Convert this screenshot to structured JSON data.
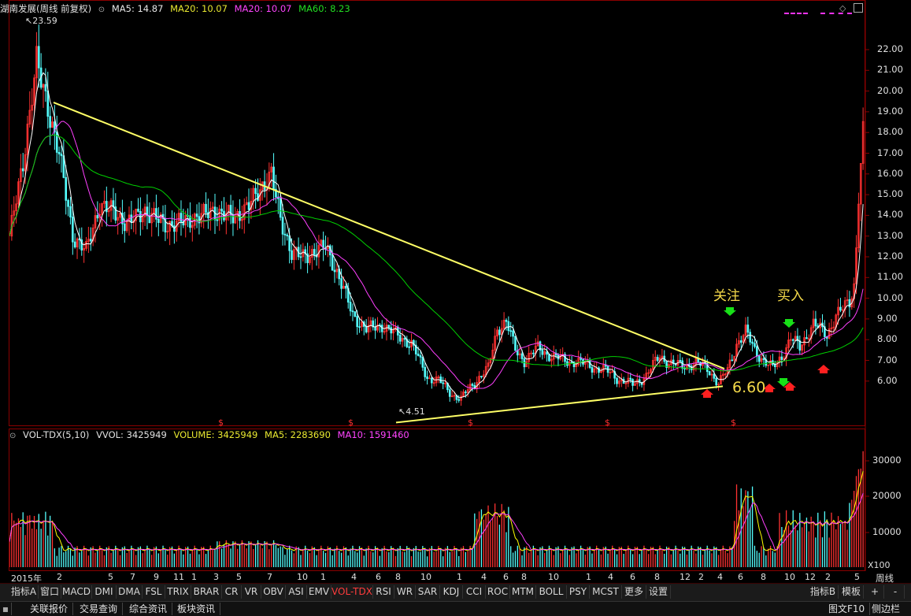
{
  "upper_header": {
    "title": "湖南发展(周线 前复权)",
    "ma5": "MA5: 14.87",
    "ma20": "MA20: 10.07",
    "ma20b": "MA20: 10.07",
    "ma60": "MA60: 8.23"
  },
  "lower_header": {
    "title": "VOL-TDX(5,10)",
    "vvol": "VVOL: 3425949",
    "volume": "VOLUME: 3425949",
    "ma5": "MA5: 2283690",
    "ma10": "MA10: 1591460"
  },
  "price_axis": [
    "22.00",
    "21.00",
    "20.00",
    "19.00",
    "18.00",
    "17.00",
    "16.00",
    "15.00",
    "14.00",
    "13.00",
    "12.00",
    "11.00",
    "10.00",
    "9.00",
    "8.00",
    "7.00",
    "6.00"
  ],
  "volume_axis": [
    "30000",
    "20000",
    "10000"
  ],
  "volume_unit": "X100",
  "time_axis": [
    "2015年",
    "2",
    "5",
    "7",
    "9",
    "11",
    "1",
    "3",
    "5",
    "7",
    "10",
    "1",
    "4",
    "6",
    "8",
    "10",
    "1",
    "4",
    "6",
    "8",
    "10",
    "1",
    "4",
    "6",
    "8",
    "12",
    "2",
    "4",
    "6",
    "8",
    "10",
    "12",
    "2",
    "5"
  ],
  "period_label": "周线",
  "annotations": {
    "high_label": "23.59",
    "low_label": "4.51",
    "watch": "关注",
    "buy": "买入",
    "breakout_price": "6.60"
  },
  "dividend_marker": "$",
  "tabs": [
    {
      "label": "指标A"
    },
    {
      "label": "窗口"
    },
    {
      "label": "MACD"
    },
    {
      "label": "DMI"
    },
    {
      "label": "DMA"
    },
    {
      "label": "FSL"
    },
    {
      "label": "TRIX"
    },
    {
      "label": "BRAR"
    },
    {
      "label": "CR"
    },
    {
      "label": "VR"
    },
    {
      "label": "OBV"
    },
    {
      "label": "ASI"
    },
    {
      "label": "EMV"
    },
    {
      "label": "VOL-TDX"
    },
    {
      "label": "RSI"
    },
    {
      "label": "WR"
    },
    {
      "label": "SAR"
    },
    {
      "label": "KDJ"
    },
    {
      "label": "CCI"
    },
    {
      "label": "ROC"
    },
    {
      "label": "MTM"
    },
    {
      "label": "BOLL"
    },
    {
      "label": "PSY"
    },
    {
      "label": "MCST"
    },
    {
      "label": "更多"
    },
    {
      "label": "设置"
    }
  ],
  "right_tabs": {
    "indicator_b": "指标B",
    "template": "模板",
    "plus": "+",
    "minus": "-"
  },
  "status_tabs": [
    "关联报价",
    "交易查询",
    "综合资讯",
    "板块资讯"
  ],
  "status_right": {
    "f10": "图文F10",
    "sidebar": "侧边栏"
  },
  "colors": {
    "up": "#ff3232",
    "down": "#54ffff",
    "ma5": "#ffffff",
    "ma20": "#ff40ff",
    "ma60": "#00d000",
    "trend": "#ffff66",
    "vol_ma5": "#ffff00",
    "vol_ma10": "#ff40ff"
  }
}
